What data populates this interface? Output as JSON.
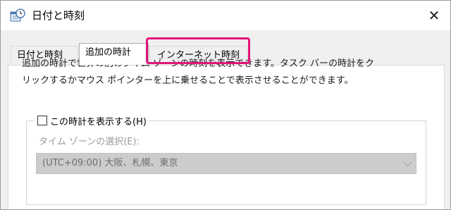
{
  "window": {
    "title": "日付と時刻",
    "icon": "date-time-icon",
    "close_glyph": "✕"
  },
  "tabs": [
    {
      "label": "日付と時刻",
      "active": false
    },
    {
      "label": "追加の時計",
      "active": true
    },
    {
      "label": "インターネット時刻",
      "active": false,
      "highlighted": true
    }
  ],
  "highlight_color": "#e2157a",
  "panel": {
    "description_line1": "追加の時計で世界の別のタイム ゾーンの時刻を表示できます。タスク バーの時計をク",
    "description_line2": "リックするかマウス ポインターを上に乗せることで表示させることができます。",
    "clock1": {
      "checkbox_label": "この時計を表示する(H)",
      "checked": false,
      "timezone_label": "タイム ゾーンの選択(E):",
      "timezone_value": "(UTC+09:00) 大阪、札幌、東京"
    }
  }
}
